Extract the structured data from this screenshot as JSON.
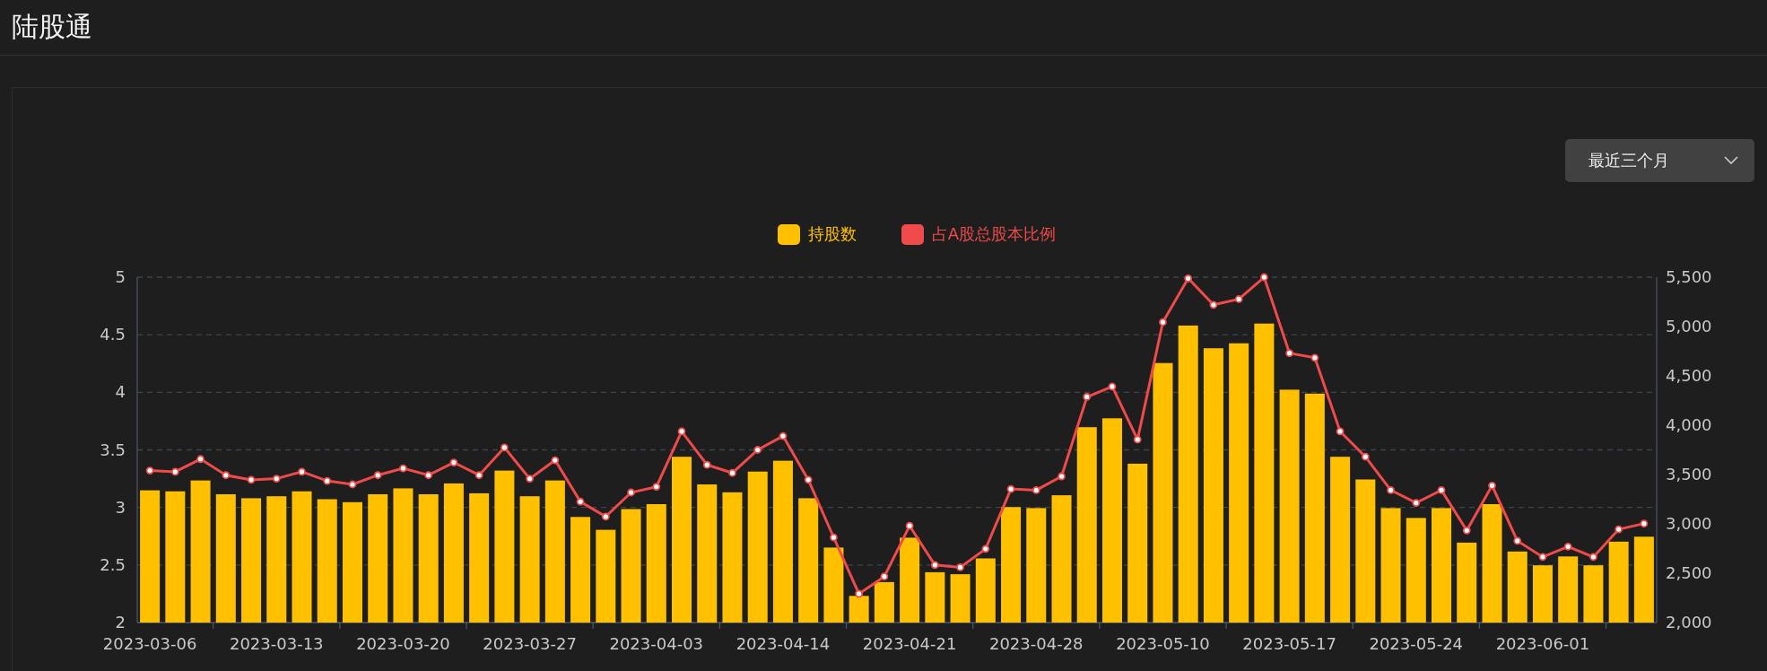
{
  "page": {
    "title": "陆股通"
  },
  "range_select": {
    "value": "最近三个月"
  },
  "chart": {
    "chart_data": {
      "type": "bar",
      "categories": [
        "2023-03-06",
        null,
        null,
        null,
        null,
        "2023-03-13",
        null,
        null,
        null,
        null,
        "2023-03-20",
        null,
        null,
        null,
        null,
        "2023-03-27",
        null,
        null,
        null,
        null,
        "2023-04-03",
        null,
        null,
        null,
        null,
        "2023-04-14",
        null,
        null,
        null,
        null,
        "2023-04-21",
        null,
        null,
        null,
        null,
        "2023-04-28",
        null,
        null,
        null,
        null,
        "2023-05-10",
        null,
        null,
        null,
        null,
        "2023-05-17",
        null,
        null,
        null,
        null,
        "2023-05-24",
        null,
        null,
        null,
        null,
        "2023-06-01",
        null,
        null,
        null,
        null
      ],
      "grid": true,
      "ylim": [
        2,
        5
      ],
      "yticks": [
        2,
        2.5,
        3,
        3.5,
        4,
        4.5,
        5
      ],
      "y2lim": [
        2000,
        5500
      ],
      "y2ticks": [
        {
          "value": 2000,
          "label": "2,000"
        },
        {
          "value": 2500,
          "label": "2,500"
        },
        {
          "value": 3000,
          "label": "3,000"
        },
        {
          "value": 3500,
          "label": "3,500"
        },
        {
          "value": 4000,
          "label": "4,000"
        },
        {
          "value": 4500,
          "label": "4,500"
        },
        {
          "value": 5000,
          "label": "5,000"
        },
        {
          "value": 5500,
          "label": "5,500"
        }
      ],
      "series": [
        {
          "name": "持股数",
          "color": "#ffc000",
          "axis": "y2",
          "values": [
            3340,
            3330,
            3440,
            3300,
            3260,
            3280,
            3330,
            3250,
            3220,
            3300,
            3360,
            3300,
            3410,
            3310,
            3540,
            3280,
            3440,
            3070,
            2940,
            3150,
            3200,
            3680,
            3400,
            3320,
            3530,
            3640,
            3260,
            2760,
            2270,
            2410,
            2860,
            2510,
            2490,
            2650,
            3170,
            3160,
            3290,
            3980,
            4070,
            3610,
            4630,
            5010,
            4780,
            4830,
            5030,
            4360,
            4320,
            3680,
            3450,
            3160,
            3060,
            3160,
            2810,
            3200,
            2720,
            2580,
            2670,
            2580,
            2820,
            2870
          ]
        },
        {
          "name": "占A股总股本比例",
          "color": "#f04a4a",
          "type": "line",
          "marker": true,
          "values": [
            3.32,
            3.31,
            3.42,
            3.28,
            3.24,
            3.25,
            3.31,
            3.23,
            3.2,
            3.28,
            3.34,
            3.28,
            3.39,
            3.28,
            3.52,
            3.25,
            3.41,
            3.05,
            2.92,
            3.13,
            3.18,
            3.66,
            3.37,
            3.3,
            3.5,
            3.62,
            3.24,
            2.74,
            2.25,
            2.4,
            2.84,
            2.5,
            2.48,
            2.64,
            3.16,
            3.15,
            3.27,
            3.96,
            4.05,
            3.59,
            4.61,
            4.99,
            4.76,
            4.81,
            5.0,
            4.34,
            4.3,
            3.66,
            3.44,
            3.15,
            3.04,
            3.15,
            2.8,
            3.19,
            2.71,
            2.57,
            2.66,
            2.57,
            2.81,
            2.86
          ]
        }
      ]
    }
  }
}
